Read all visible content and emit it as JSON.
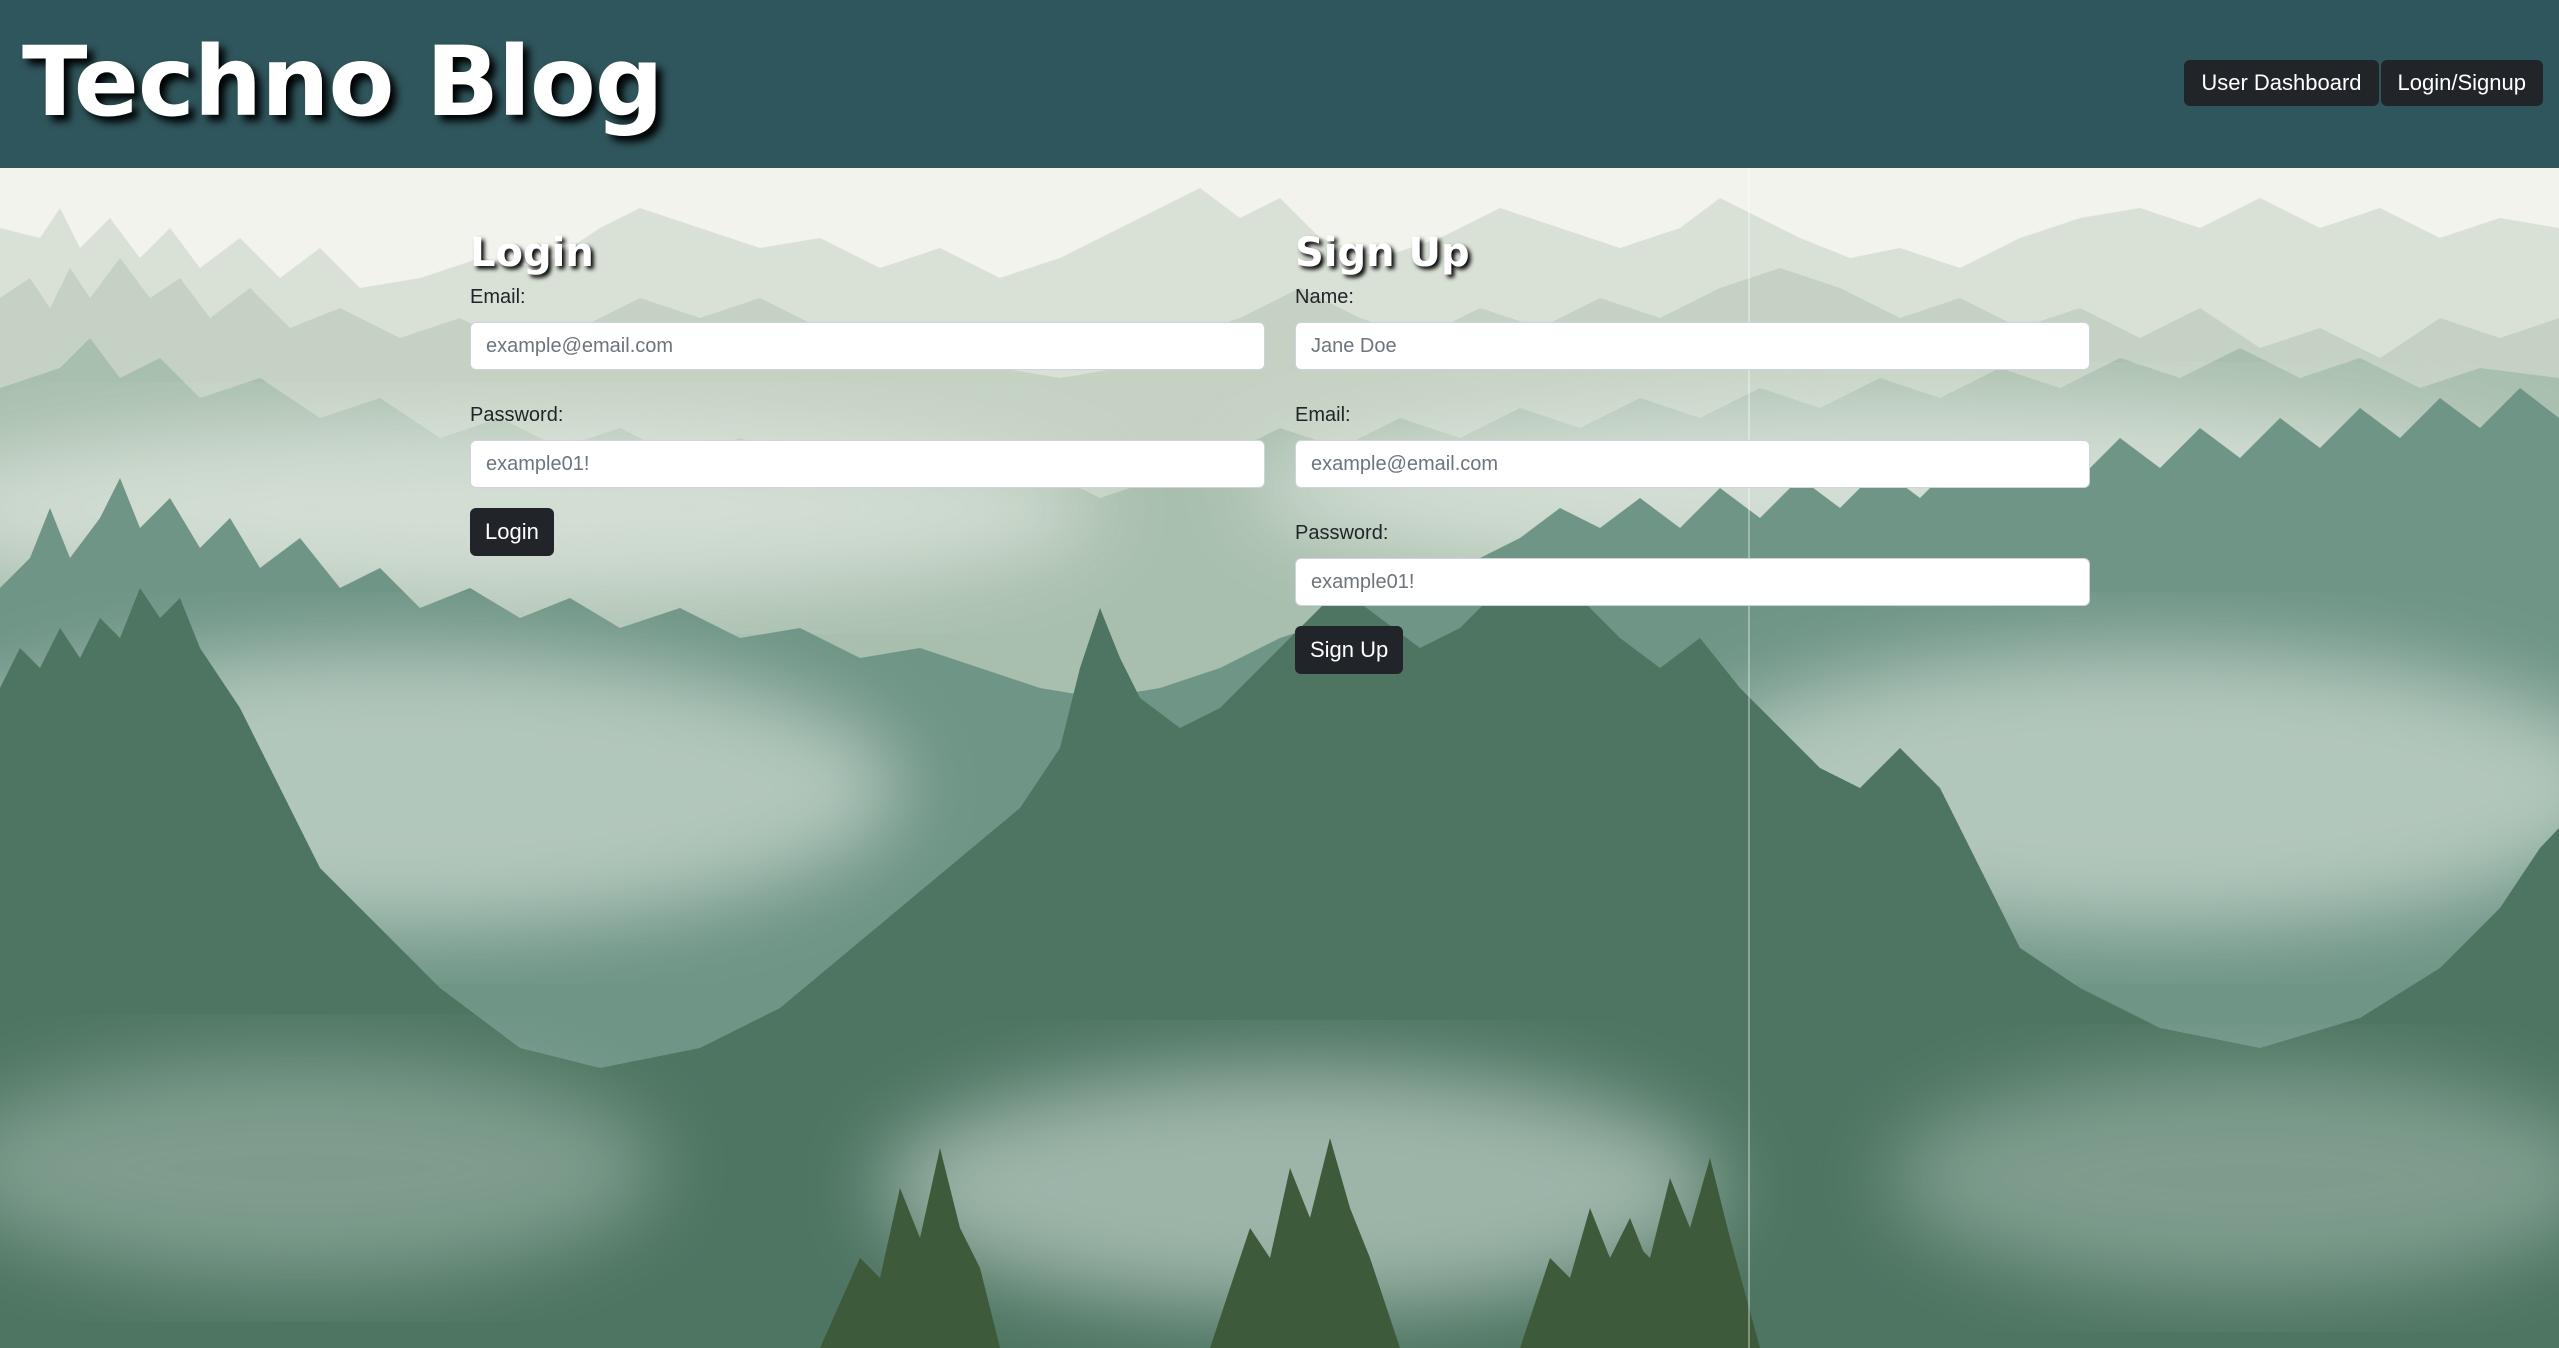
{
  "header": {
    "brand": "Techno Blog",
    "nav": {
      "dashboard_label": "User Dashboard",
      "login_signup_label": "Login/Signup"
    },
    "background_color": "#2f565c"
  },
  "login": {
    "title": "Login",
    "email_label": "Email:",
    "email_placeholder": "example@email.com",
    "password_label": "Password:",
    "password_placeholder": "example01!",
    "submit_label": "Login"
  },
  "signup": {
    "title": "Sign Up",
    "name_label": "Name:",
    "name_placeholder": "Jane Doe",
    "email_label": "Email:",
    "email_placeholder": "example@email.com",
    "password_label": "Password:",
    "password_placeholder": "example01!",
    "submit_label": "Sign Up"
  },
  "colors": {
    "button_dark": "#212529",
    "forest_light": "#cfd8cc",
    "forest_mid": "#6f9586",
    "forest_dark": "#4e7562",
    "forest_darkest": "#3d5a3a"
  }
}
